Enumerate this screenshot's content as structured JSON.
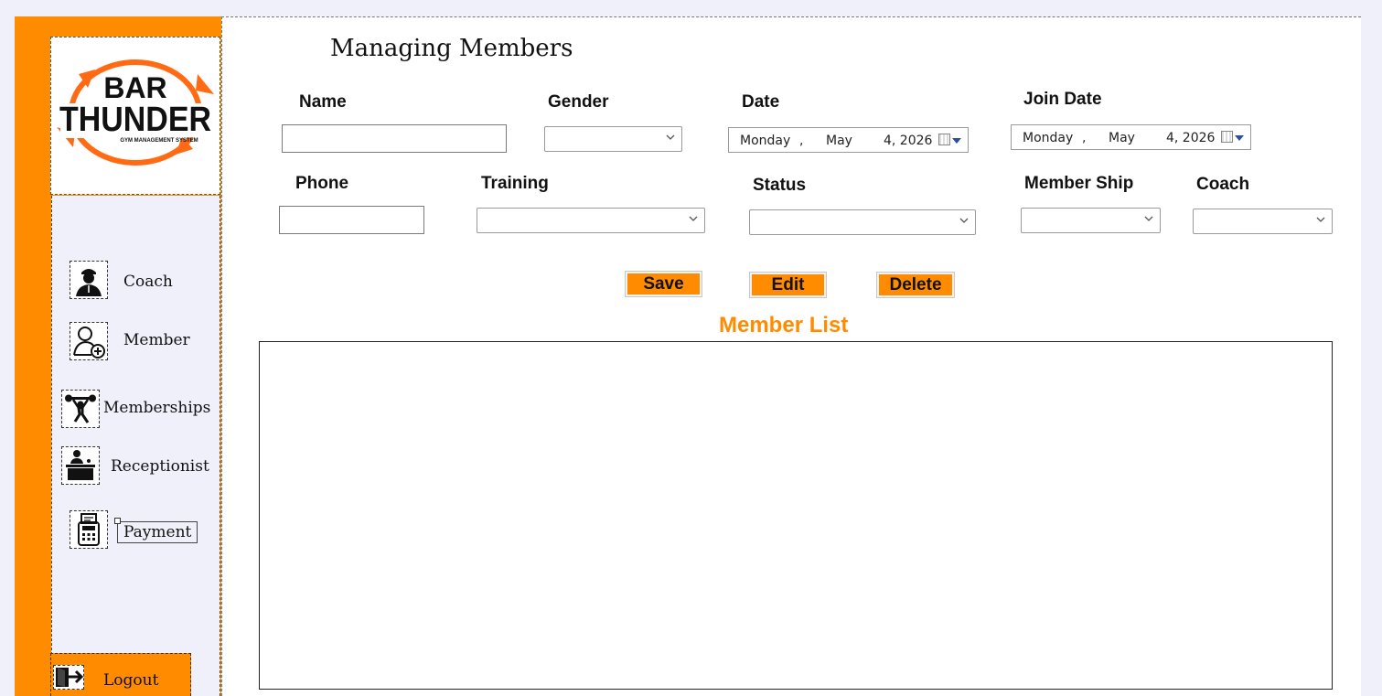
{
  "colors": {
    "accent": "#ff8c00",
    "background": "#eff0fa",
    "panel": "#ffffff"
  },
  "logo": {
    "line1": "BAR",
    "line2": "THUNDER",
    "tagline": "GYM MANAGEMENT SYSTEM"
  },
  "sidebar": {
    "items": [
      {
        "label": "Coach",
        "icon": "coach-icon"
      },
      {
        "label": "Member",
        "icon": "add-member-icon"
      },
      {
        "label": "Memberships",
        "icon": "weightlifter-icon"
      },
      {
        "label": "Receptionist",
        "icon": "receptionist-icon"
      },
      {
        "label": "Payment",
        "icon": "payment-terminal-icon"
      }
    ],
    "logout": {
      "label": "Logout",
      "icon": "logout-icon"
    }
  },
  "page": {
    "title": "Managing Members"
  },
  "form": {
    "name": {
      "label": "Name",
      "value": ""
    },
    "gender": {
      "label": "Gender",
      "value": ""
    },
    "date": {
      "label": "Date",
      "day": "Monday",
      "sep": ",",
      "month": "May",
      "daynum_year": "4, 2026"
    },
    "join_date": {
      "label": "Join Date",
      "day": "Monday",
      "sep": ",",
      "month": "May",
      "daynum_year": "4, 2026"
    },
    "phone": {
      "label": "Phone",
      "value": ""
    },
    "training": {
      "label": "Training",
      "value": ""
    },
    "status": {
      "label": "Status",
      "value": ""
    },
    "membership": {
      "label": "Member Ship",
      "value": ""
    },
    "coach": {
      "label": "Coach",
      "value": ""
    }
  },
  "actions": {
    "save": "Save",
    "edit": "Edit",
    "delete": "Delete"
  },
  "member_list": {
    "title": "Member List",
    "rows": []
  }
}
